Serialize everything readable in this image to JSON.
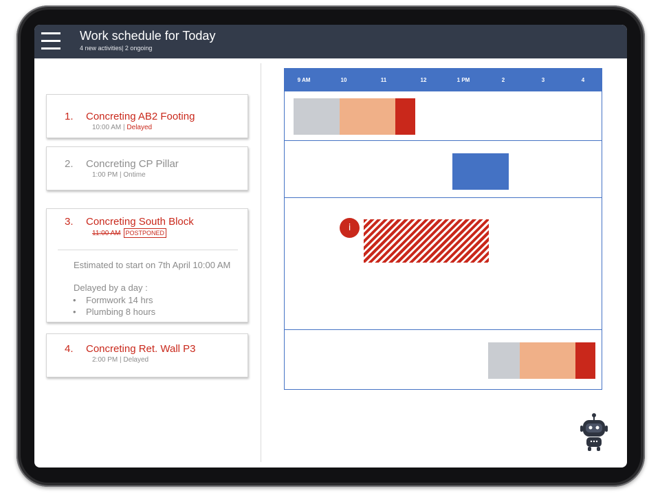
{
  "header": {
    "title": "Work schedule for Today",
    "subtitle": "4 new activities| 2 ongoing"
  },
  "activities": [
    {
      "number": "1.",
      "name": "Concreting AB2 Footing",
      "time": "10:00 AM",
      "separator": " | ",
      "status": "Delayed"
    },
    {
      "number": "2.",
      "name": "Concreting CP Pillar",
      "time": "1:00 PM",
      "separator": " | ",
      "status": "Ontime"
    },
    {
      "number": "3.",
      "name": "Concreting South Block",
      "time": "11:00 AM",
      "status": "POSTPONED",
      "estimate": "Estimated to start on 7th April 10:00 AM",
      "delay_note": "Delayed by a day :",
      "delay_items": [
        "Formwork 14 hrs",
        "Plumbing 8 hours"
      ]
    },
    {
      "number": "4.",
      "name": "Concreting Ret. Wall P3",
      "time": "2:00 PM",
      "separator": " | ",
      "status": "Delayed"
    }
  ],
  "timeline": {
    "hours": [
      "9 AM",
      "10",
      "11",
      "12",
      "1 PM",
      "2",
      "3",
      "4"
    ],
    "info_icon": "i"
  },
  "colors": {
    "header_bg": "#333b4a",
    "accent_red": "#c9281b",
    "timeline_blue": "#4472c4",
    "planned_gray": "#c9ccd1",
    "progress_peach": "#f0b088"
  },
  "icons": {
    "menu": "hamburger-icon",
    "info": "info-icon",
    "assistant": "robot-icon"
  }
}
